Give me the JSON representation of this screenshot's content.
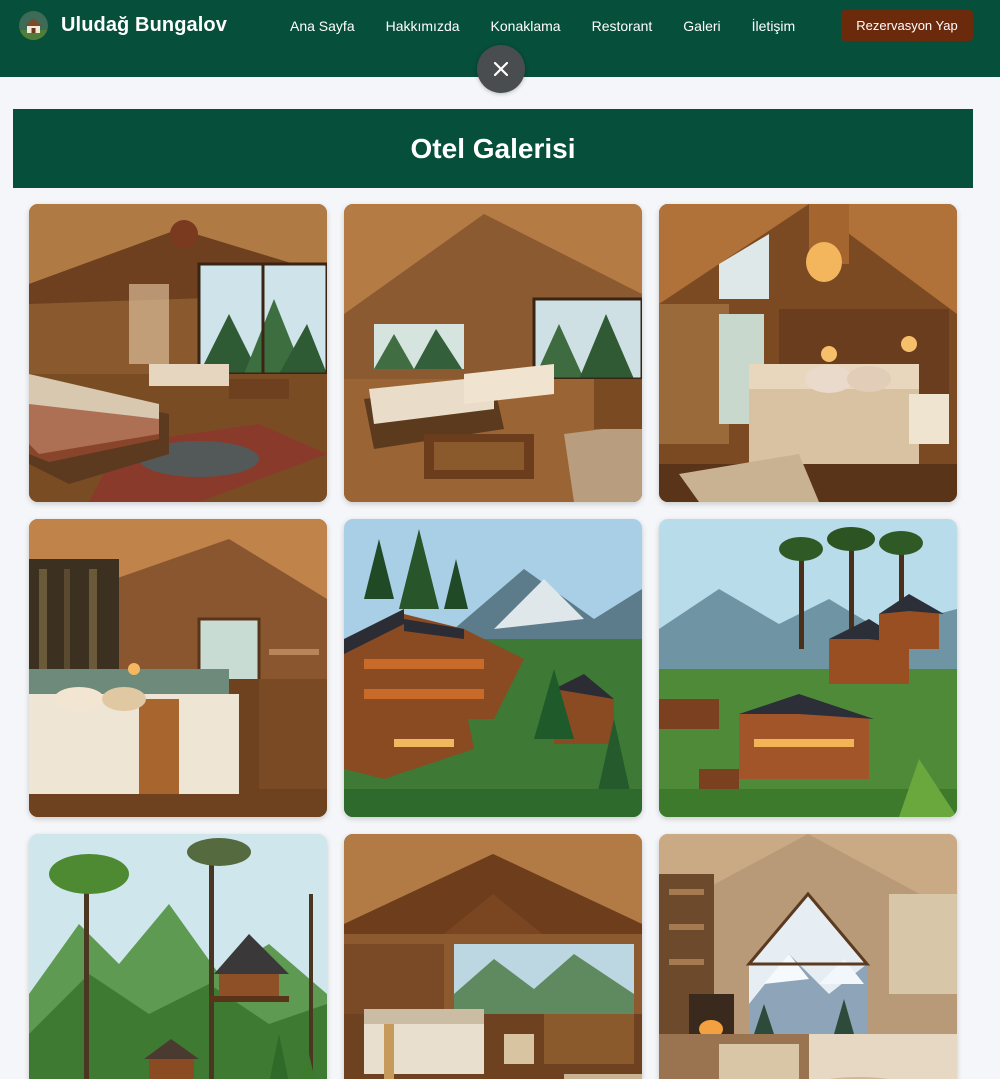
{
  "brand": {
    "name": "Uludağ Bungalov",
    "logo_icon": "bungalow-logo-icon"
  },
  "nav": {
    "links": [
      "Ana Sayfa",
      "Hakkımızda",
      "Konaklama",
      "Restorant",
      "Galeri",
      "İletişim"
    ],
    "cta_label": "Rezervasyon Yap"
  },
  "overlay": {
    "close_icon": "close-icon"
  },
  "gallery": {
    "title": "Otel Galerisi",
    "images": [
      {
        "scene": "bedroom-forest-view"
      },
      {
        "scene": "loft-room-balcony"
      },
      {
        "scene": "attic-bedroom-lanterns"
      },
      {
        "scene": "cozy-bedroom-forest-mural"
      },
      {
        "scene": "hillside-bungalows-mountains"
      },
      {
        "scene": "bungalows-pine-hills"
      },
      {
        "scene": "treehouse-mountain-valley"
      },
      {
        "scene": "vaulted-suite-mountain-view"
      },
      {
        "scene": "winter-chalet-fireplace"
      }
    ]
  },
  "colors": {
    "header_bg": "#064f3a",
    "cta_bg": "#6b2a0c",
    "page_bg": "#f4f6f9",
    "close_bg": "#4a4d50"
  }
}
